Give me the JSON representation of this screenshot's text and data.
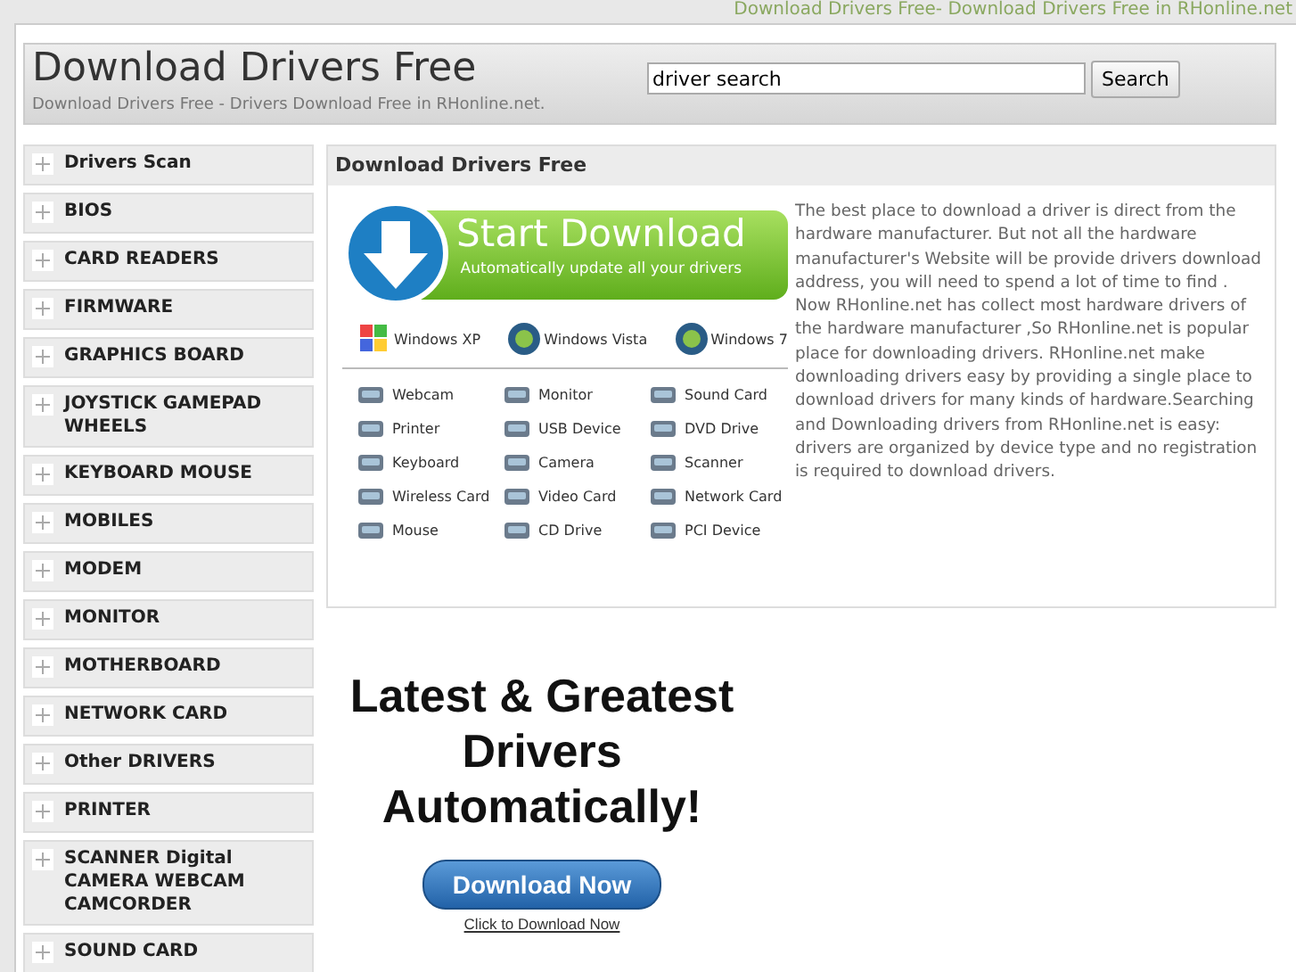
{
  "top_link": "Download Drivers Free- Download Drivers Free in RHonline.net",
  "header": {
    "title": "Download Drivers Free",
    "subtitle": "Download Drivers Free - Drivers Download Free in RHonline.net.",
    "search": {
      "value": "driver search",
      "button": "Search"
    }
  },
  "sidebar": {
    "items": [
      {
        "label": "Drivers Scan"
      },
      {
        "label": "BIOS"
      },
      {
        "label": "CARD READERS"
      },
      {
        "label": "FIRMWARE"
      },
      {
        "label": "GRAPHICS BOARD"
      },
      {
        "label": "JOYSTICK GAMEPAD WHEELS"
      },
      {
        "label": "KEYBOARD MOUSE"
      },
      {
        "label": "MOBILES"
      },
      {
        "label": "MODEM"
      },
      {
        "label": "MONITOR"
      },
      {
        "label": "MOTHERBOARD"
      },
      {
        "label": "NETWORK CARD"
      },
      {
        "label": "Other DRIVERS"
      },
      {
        "label": "PRINTER"
      },
      {
        "label": "SCANNER Digital CAMERA WEBCAM CAMCORDER"
      },
      {
        "label": "SOUND CARD"
      }
    ]
  },
  "panel": {
    "title": "Download Drivers Free",
    "banner": {
      "title": "Start Download",
      "subtitle": "Automatically update all your drivers"
    },
    "os": [
      {
        "kind": "flag",
        "label": "Windows XP"
      },
      {
        "kind": "orb",
        "label": "Windows Vista"
      },
      {
        "kind": "orb",
        "label": "Windows 7"
      }
    ],
    "devices": [
      "Webcam",
      "Monitor",
      "Sound Card",
      "Printer",
      "USB Device",
      "DVD Drive",
      "Keyboard",
      "Camera",
      "Scanner",
      "Wireless Card",
      "Video Card",
      "Network Card",
      "Mouse",
      "CD Drive",
      "PCI Device"
    ],
    "description": "The best place to download a driver is direct from the hardware manufacturer. But not all the hardware manufacturer's Website will be provide drivers download address, you will need to spend a lot of time to find . Now RHonline.net has collect most hardware drivers of the hardware manufacturer ,So RHonline.net is popular place for downloading drivers. RHonline.net make downloading drivers easy by providing a single place to download drivers for many kinds of hardware.Searching and Downloading drivers from RHonline.net is easy: drivers are organized by device type and no registration is required to download drivers."
  },
  "ad": {
    "headline": "Latest & Greatest Drivers Automatically!",
    "button": "Download Now",
    "link": "Click to Download Now"
  }
}
